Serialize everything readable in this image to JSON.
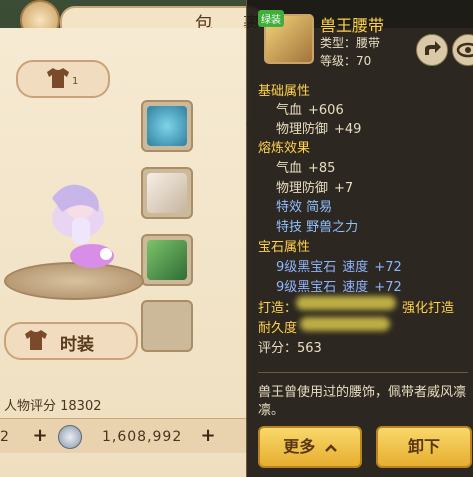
{
  "window": {
    "title": "包 裹"
  },
  "left": {
    "outfit_tab_num": "1",
    "fashion_label": "时装",
    "score_text": "人物评分 18302",
    "currency_left": "2",
    "money": "1,608,992"
  },
  "item": {
    "badge": "绿装",
    "name": "兽王腰带",
    "type": "类型：腰带",
    "level": "等级：70",
    "sections": {
      "base": "基础属性",
      "refine": "熔炼效果",
      "gem": "宝石属性"
    },
    "base_attrs": [
      {
        "name": "气血",
        "value": "+606"
      },
      {
        "name": "物理防御",
        "value": "+49"
      }
    ],
    "refine_attrs": [
      {
        "name": "气血",
        "value": "+85"
      },
      {
        "name": "物理防御",
        "value": "+7"
      }
    ],
    "special_effect": "特效  简易",
    "special_skill": "特技  野兽之力",
    "gems": [
      {
        "name": "9级黑宝石",
        "attr": "速度",
        "value": "+72"
      },
      {
        "name": "9级黑宝石",
        "attr": "速度",
        "value": "+72"
      }
    ],
    "craft_label": "打造：",
    "craft_value": "强化打造",
    "durability_label": "耐久度",
    "score_label": "评分：563",
    "description": "兽王曾使用过的腰饰，佩带者威风凛凛。",
    "buttons": {
      "more": "更多",
      "remove": "卸下"
    }
  }
}
